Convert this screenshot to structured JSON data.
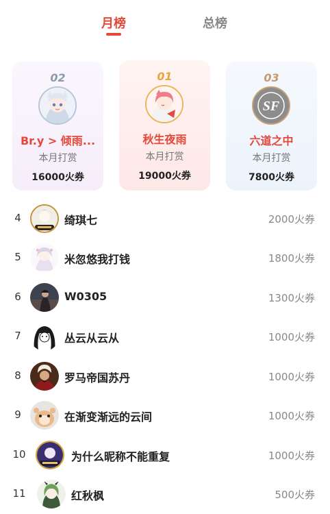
{
  "tabs": {
    "monthly": "月榜",
    "total": "总榜"
  },
  "top3": [
    {
      "rank": "02",
      "name": "Br.y > 倾雨...",
      "caption": "本月打赏",
      "amount": "16000火券"
    },
    {
      "rank": "01",
      "name": "秋生夜雨",
      "caption": "本月打赏",
      "amount": "19000火券"
    },
    {
      "rank": "03",
      "name": "六道之中",
      "caption": "本月打赏",
      "amount": "7800火券"
    }
  ],
  "rows": [
    {
      "rank": "4",
      "name": "绮琪七",
      "amount": "2000火券"
    },
    {
      "rank": "5",
      "name": "米忽悠我打钱",
      "amount": "1800火券"
    },
    {
      "rank": "6",
      "name": "W0305",
      "amount": "1300火券"
    },
    {
      "rank": "7",
      "name": "丛云从云从",
      "amount": "1000火券"
    },
    {
      "rank": "8",
      "name": "罗马帝国苏丹",
      "amount": "1000火券"
    },
    {
      "rank": "9",
      "name": "在渐变渐远的云间",
      "amount": "1000火券"
    },
    {
      "rank": "10",
      "name": "为什么昵称不能重复",
      "amount": "1000火券"
    },
    {
      "rank": "11",
      "name": "红秋枫",
      "amount": "500火券"
    }
  ],
  "colors": {
    "accent": "#e5483a",
    "gold": "#e7a53b",
    "silver": "#8a9bb0",
    "bronze": "#c59a6e"
  },
  "third_avatar_logo": "SF"
}
